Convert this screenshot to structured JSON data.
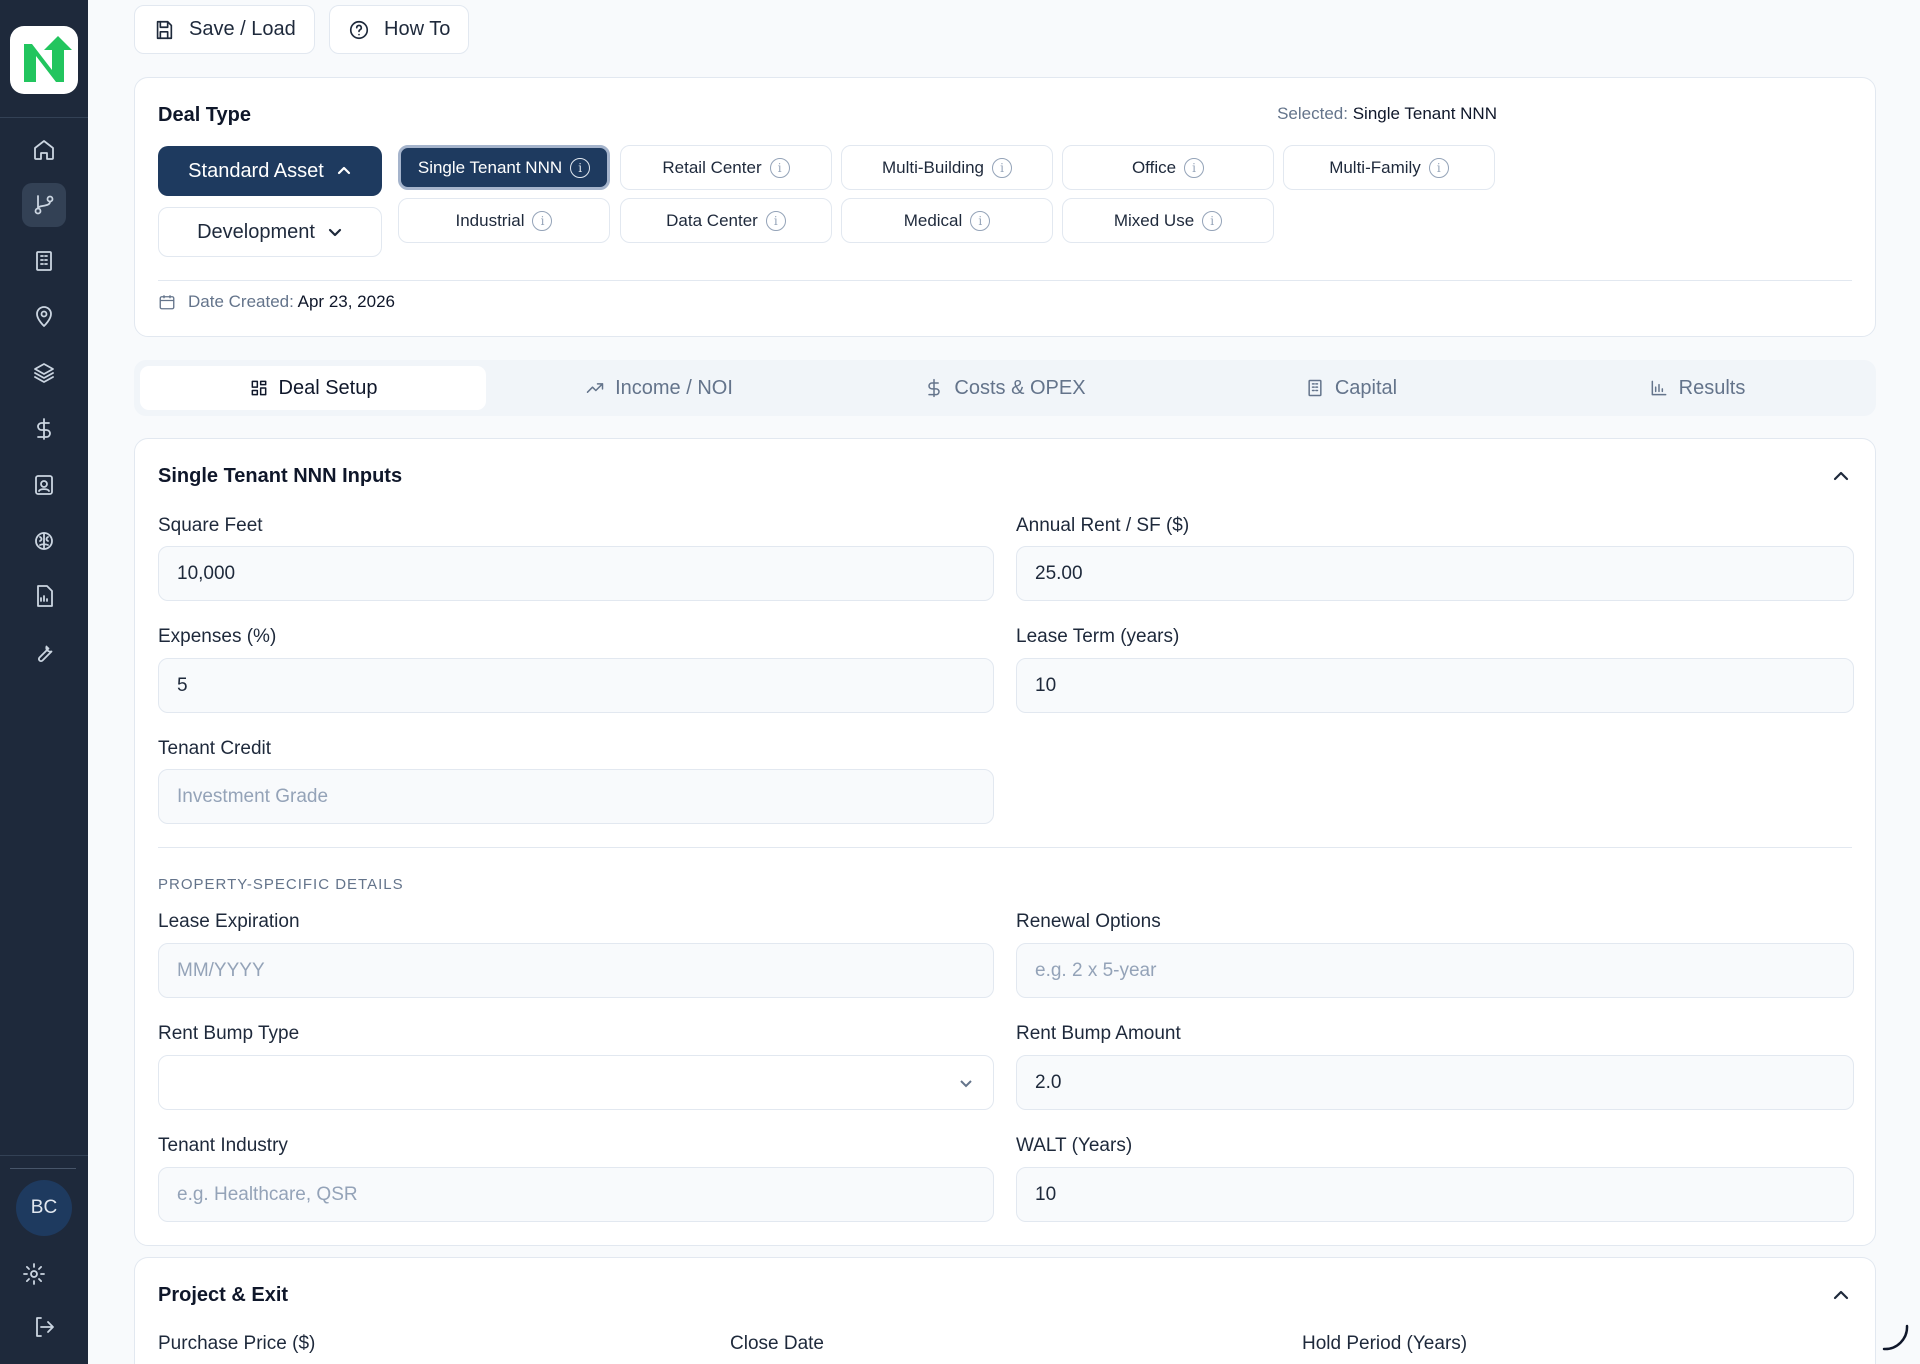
{
  "toolbar": {
    "save_load_label": "Save / Load",
    "how_to_label": "How To"
  },
  "sidebar": {
    "items": [
      {
        "icon": "home-icon"
      },
      {
        "icon": "git-branch-icon"
      },
      {
        "icon": "building-icon"
      },
      {
        "icon": "map-pin-icon"
      },
      {
        "icon": "layers-icon"
      },
      {
        "icon": "dollar-icon"
      },
      {
        "icon": "contact-icon"
      },
      {
        "icon": "brain-icon"
      },
      {
        "icon": "report-icon"
      },
      {
        "icon": "wrench-icon"
      }
    ],
    "avatar_initials": "BC"
  },
  "deal_type": {
    "title": "Deal Type",
    "selected_prefix": "Selected:",
    "selected_value": "Single Tenant NNN",
    "standard_asset_label": "Standard Asset",
    "development_label": "Development",
    "chips": [
      "Single Tenant NNN",
      "Retail Center",
      "Multi-Building",
      "Office",
      "Multi-Family",
      "Industrial",
      "Data Center",
      "Medical",
      "Mixed Use"
    ],
    "date_created_label": "Date Created:",
    "date_created_value": "Apr 23, 2026"
  },
  "tabs": [
    "Deal Setup",
    "Income / NOI",
    "Costs & OPEX",
    "Capital",
    "Results"
  ],
  "inputs_section": {
    "title": "Single Tenant NNN Inputs",
    "square_feet": {
      "label": "Square Feet",
      "value": "10,000"
    },
    "annual_rent": {
      "label": "Annual Rent / SF ($)",
      "value": "25.00"
    },
    "expenses": {
      "label": "Expenses (%)",
      "value": "5"
    },
    "lease_term": {
      "label": "Lease Term (years)",
      "value": "10"
    },
    "tenant_credit": {
      "label": "Tenant Credit",
      "placeholder": "Investment Grade"
    },
    "property_details_caption": "PROPERTY-SPECIFIC DETAILS",
    "lease_expiration": {
      "label": "Lease Expiration",
      "placeholder": "MM/YYYY"
    },
    "renewal_options": {
      "label": "Renewal Options",
      "placeholder": "e.g. 2 x 5-year"
    },
    "rent_bump_type": {
      "label": "Rent Bump Type",
      "value": ""
    },
    "rent_bump_amount": {
      "label": "Rent Bump Amount",
      "value": "2.0"
    },
    "tenant_industry": {
      "label": "Tenant Industry",
      "placeholder": "e.g. Healthcare, QSR"
    },
    "walt": {
      "label": "WALT (Years)",
      "value": "10"
    }
  },
  "project_exit": {
    "title": "Project & Exit",
    "purchase_price_label": "Purchase Price ($)",
    "close_date_label": "Close Date",
    "hold_period_label": "Hold Period (Years)"
  },
  "colors": {
    "sidebar": "#1e293b",
    "accent": "#1e3a5f",
    "background": "#f8fafc"
  }
}
